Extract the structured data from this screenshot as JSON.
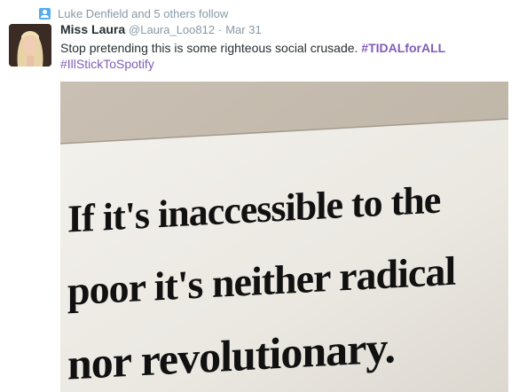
{
  "context": {
    "icon": "follow-icon",
    "text": "Luke Denfield and 5 others follow"
  },
  "tweet": {
    "author_name": "Miss Laura",
    "handle": "@Laura_Loo812",
    "separator": "·",
    "date": "Mar 31",
    "text_plain": "Stop pretending this is some righteous social crusade. ",
    "hashtag_1": "#TIDALforALL",
    "hashtag_2": "#IllStickToSpotify",
    "accent_color": "#7e5db8"
  },
  "media": {
    "sign_line_1": "If it's inaccessible to the",
    "sign_line_2": "poor it's neither radical",
    "sign_line_3": "nor revolutionary."
  }
}
